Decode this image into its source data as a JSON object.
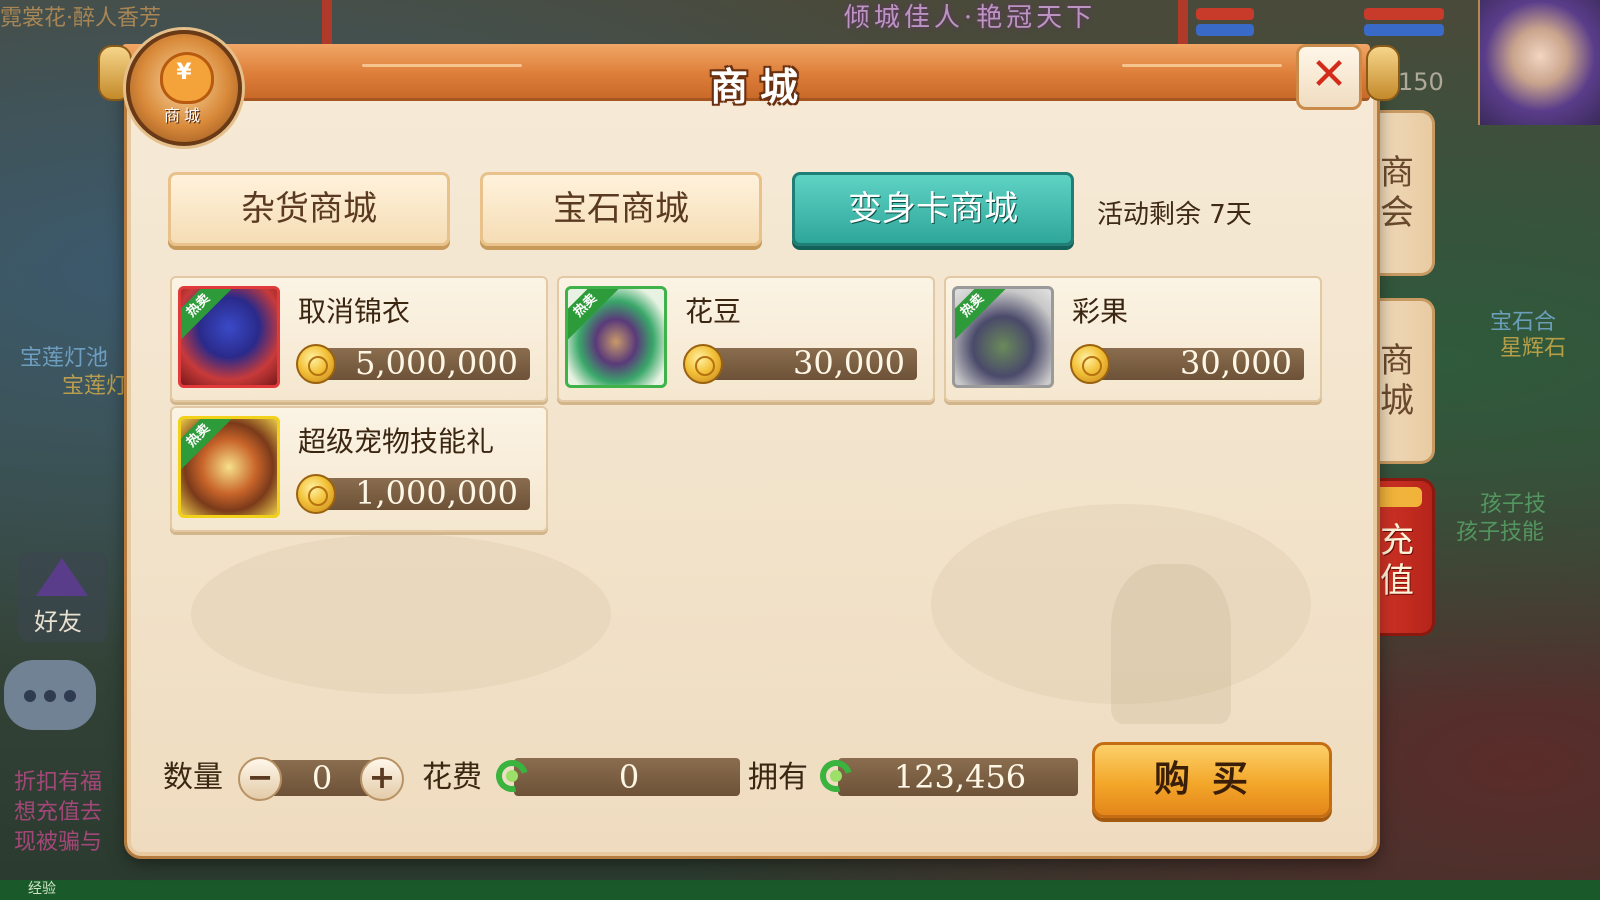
{
  "background": {
    "banner": "倾城佳人·艳冠天下",
    "left_top": "霓裳花·醉人香芳",
    "left_texts": [
      "宝莲灯池",
      "宝莲灯"
    ],
    "left_lower_texts": [
      "折扣有福",
      "想充值去",
      "现被骗与"
    ],
    "right_texts": [
      "宝石合",
      "星辉石",
      "孩子技",
      "孩子技能"
    ],
    "friend_label": "好友",
    "level_number": "150",
    "exp_label": "经验"
  },
  "dialog": {
    "title": "商城",
    "logo_text": "商城",
    "close_label": "✕"
  },
  "tabs": [
    {
      "label": "杂货商城",
      "active": false
    },
    {
      "label": "宝石商城",
      "active": false
    },
    {
      "label": "变身卡商城",
      "active": true
    }
  ],
  "event_remaining": "活动剩余 7天",
  "items": [
    {
      "name": "取消锦衣",
      "price": "5,000,000",
      "badge": "热卖",
      "icon": "costume-icon",
      "border": "#e03a3a"
    },
    {
      "name": "花豆",
      "price": "30,000",
      "badge": "热卖",
      "icon": "bean-icon",
      "border": "#3fb24a"
    },
    {
      "name": "彩果",
      "price": "30,000",
      "badge": "热卖",
      "icon": "gourd-icon",
      "border": "#9a9a9a"
    },
    {
      "name": "超级宠物技能礼",
      "price": "1,000,000",
      "badge": "热卖",
      "icon": "treasure-chest-icon",
      "border": "#f2d11a"
    }
  ],
  "bottom": {
    "quantity_label": "数量",
    "quantity_value": "0",
    "minus": "−",
    "plus": "+",
    "cost_label": "花费",
    "cost_value": "0",
    "owned_label": "拥有",
    "owned_value": "123,456",
    "buy_label": "购买"
  },
  "side_tabs": [
    {
      "label": "商会"
    },
    {
      "label": "商城"
    },
    {
      "label": "充值"
    }
  ]
}
